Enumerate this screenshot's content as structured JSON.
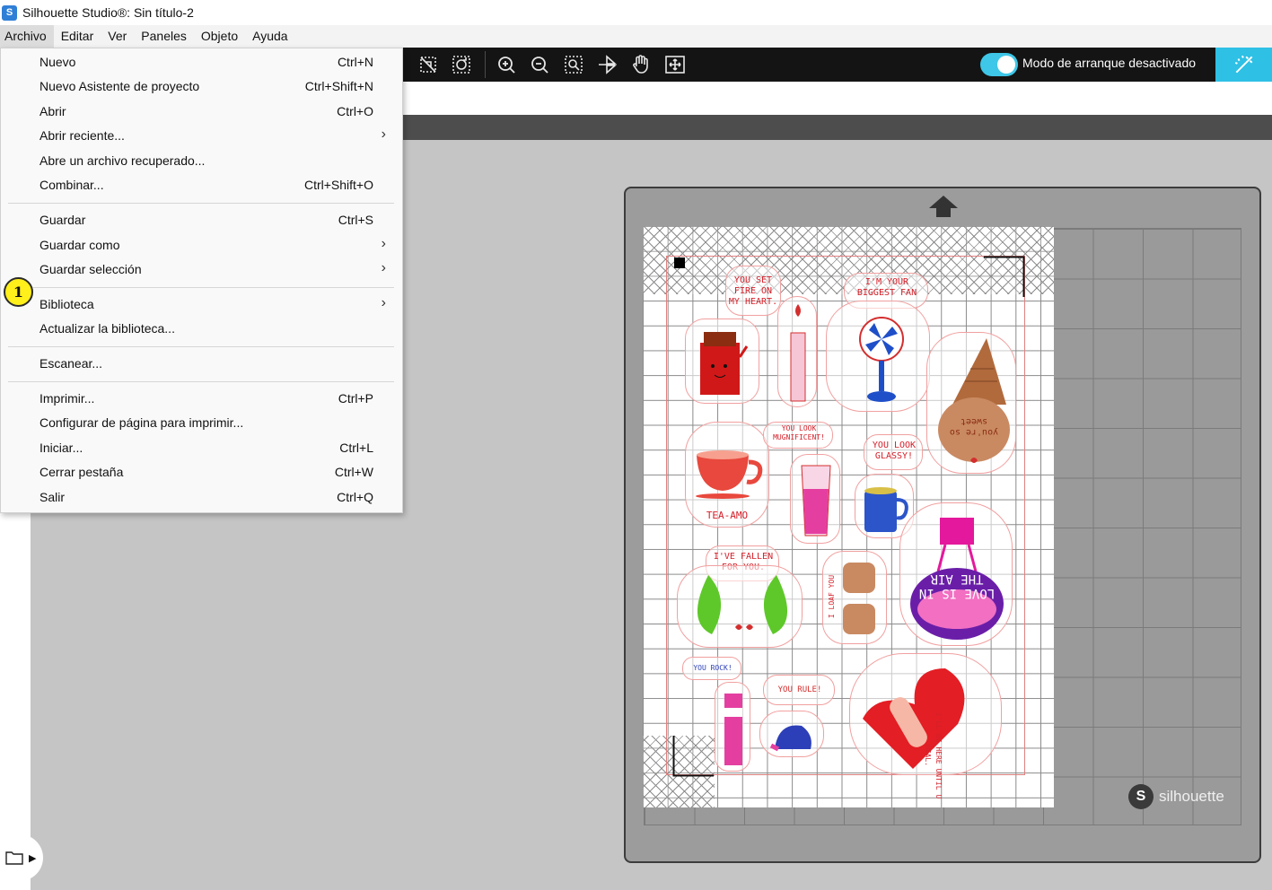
{
  "window": {
    "title": "Silhouette Studio®: Sin título-2",
    "app_icon": "silhouette-logo-icon"
  },
  "menubar": {
    "items": [
      "Archivo",
      "Editar",
      "Ver",
      "Paneles",
      "Objeto",
      "Ayuda"
    ],
    "active": "Archivo"
  },
  "toolbar": {
    "icons": [
      "release-compound-icon",
      "rotate-icon",
      "zoom-in-icon",
      "zoom-out-icon",
      "zoom-fit-icon",
      "flip-icon",
      "pan-hand-icon",
      "fit-to-page-icon"
    ],
    "mode_label": "Modo de arranque desactivado",
    "accent": "#2ec0e5"
  },
  "archivo_menu": {
    "items": [
      {
        "label": "Nuevo",
        "shortcut": "Ctrl+N"
      },
      {
        "label": "Nuevo Asistente de proyecto",
        "shortcut": "Ctrl+Shift+N"
      },
      {
        "label": "Abrir",
        "shortcut": "Ctrl+O"
      },
      {
        "label": "Abrir reciente...",
        "submenu": true
      },
      {
        "label": "Abre un archivo recuperado..."
      },
      {
        "label": "Combinar...",
        "shortcut": "Ctrl+Shift+O"
      },
      {
        "label": "Guardar",
        "shortcut": "Ctrl+S"
      },
      {
        "label": "Guardar como",
        "submenu": true
      },
      {
        "label": "Guardar selección",
        "submenu": true
      },
      {
        "label": "Biblioteca",
        "submenu": true
      },
      {
        "label": "Actualizar la biblioteca..."
      },
      {
        "label": "Escanear..."
      },
      {
        "label": "Imprimir...",
        "shortcut": "Ctrl+P"
      },
      {
        "label": "Configurar de página para imprimir..."
      },
      {
        "label": "Iniciar...",
        "shortcut": "Ctrl+L"
      },
      {
        "label": "Cerrar pestaña",
        "shortcut": "Ctrl+W"
      },
      {
        "label": "Salir",
        "shortcut": "Ctrl+Q"
      }
    ],
    "callout_badge": "1"
  },
  "mat": {
    "logo_text": "silhouette"
  },
  "stickers": {
    "fire": "YOU SET FIRE ON MY HEART.",
    "fan": "I'M YOUR BIGGEST FAN",
    "tea": "TEA-AMO",
    "magnificent": "YOU LOOK MUGNIFICENT!",
    "glassy": "YOU LOOK GLASSY!",
    "sweet": "you're so sweet",
    "fallen": "I'VE FALLEN FOR YOU.",
    "loaf": "I LOAF YOU",
    "love": "LOVE IS IN THE AIR",
    "rock": "YOU ROCK!",
    "rule": "YOU RULE!",
    "heal": "I'LL BE HERE UNTIL U HEAL."
  }
}
